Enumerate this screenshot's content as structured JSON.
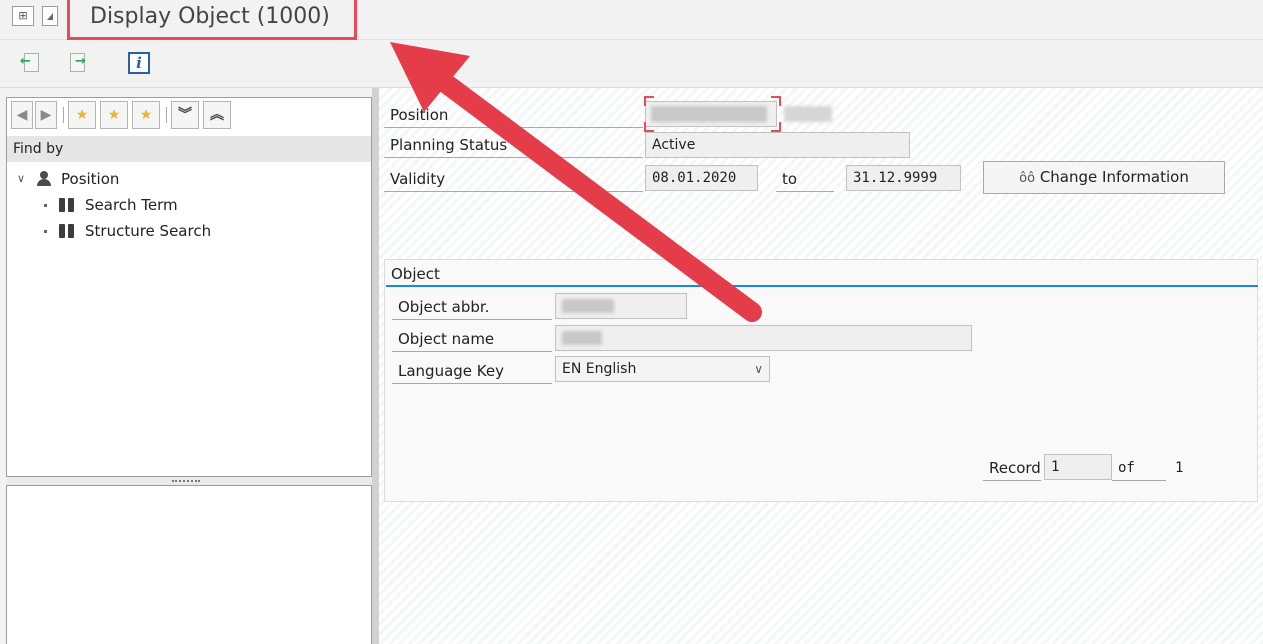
{
  "title_bar": {
    "title": "Display Object (1000)"
  },
  "left_panel": {
    "find_by_label": "Find by",
    "tree": [
      {
        "label": "Position"
      },
      {
        "label": "Search Term"
      },
      {
        "label": "Structure Search"
      }
    ]
  },
  "header_fields": {
    "position_label": "Position",
    "planning_status_label": "Planning Status",
    "planning_status_value": "Active",
    "validity_label": "Validity",
    "validity_from": "08.01.2020",
    "validity_to_label": "to",
    "validity_to": "31.12.9999",
    "change_info_button": "Change Information",
    "change_info_icon": "glasses-icon"
  },
  "object_group": {
    "title": "Object",
    "abbr_label": "Object abbr.",
    "name_label": "Object name",
    "language_label": "Language Key",
    "language_value": "EN English"
  },
  "record_nav": {
    "record_label": "Record",
    "record_value": "1",
    "of_label": "of",
    "total": "1"
  },
  "colors": {
    "highlight_red": "#e84a57",
    "group_line_blue": "#1b8ad1"
  }
}
